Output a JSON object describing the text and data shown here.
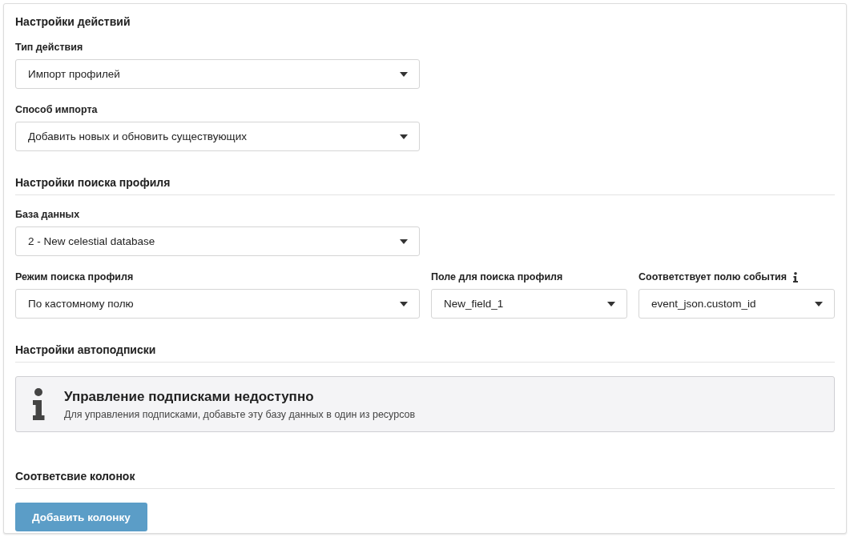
{
  "blocks": [
    {
      "kind": "title",
      "text": "Настройки действий"
    },
    {
      "kind": "fields",
      "fields": [
        {
          "label": "Тип действия",
          "value": "Импорт профилей",
          "info": false
        }
      ]
    },
    {
      "kind": "fields",
      "fields": [
        {
          "label": "Способ импорта",
          "value": "Добавить новых и обновить существующих",
          "info": false
        }
      ]
    },
    {
      "kind": "heading",
      "text": "Настройки поиска профиля"
    },
    {
      "kind": "fields",
      "fields": [
        {
          "label": "База данных",
          "value": "2 - New celestial database",
          "info": false
        }
      ]
    },
    {
      "kind": "fields",
      "fields": [
        {
          "label": "Режим поиска профиля",
          "value": "По кастомному полю",
          "info": false
        },
        {
          "label": "Поле для поиска профиля",
          "value": "New_field_1",
          "info": false
        },
        {
          "label": "Соответствует полю события",
          "value": "event_json.custom_id",
          "info": true
        }
      ]
    },
    {
      "kind": "heading",
      "text": "Настройки автоподписки"
    },
    {
      "kind": "notice",
      "title": "Управление подписками недоступно",
      "text": "Для управления подписками, добавьте эту базу данных в один из ресурсов"
    },
    {
      "kind": "heading",
      "text": "Соответсвие колонок"
    },
    {
      "kind": "button",
      "label": "Добавить колонку"
    }
  ]
}
